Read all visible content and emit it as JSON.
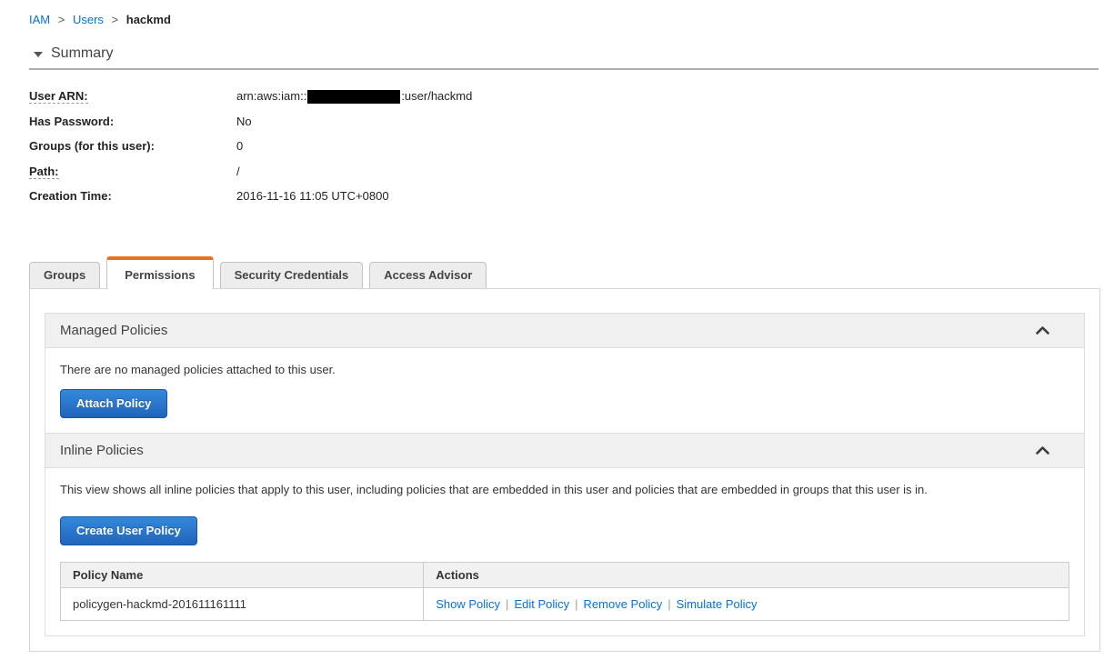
{
  "breadcrumb": {
    "separator": ">",
    "items": [
      {
        "label": "IAM"
      },
      {
        "label": "Users"
      },
      {
        "label": "hackmd"
      }
    ]
  },
  "summary": {
    "title": "Summary",
    "fields": [
      {
        "label": "User ARN:",
        "value_prefix": "arn:aws:iam::",
        "value_redacted": "account-id-redacted",
        "value_suffix": ":user/hackmd"
      },
      {
        "label": "Has Password:",
        "value": "No"
      },
      {
        "label": "Groups (for this user):",
        "value": "0"
      },
      {
        "label": "Path:",
        "value": "/"
      },
      {
        "label": "Creation Time:",
        "value": "2016-11-16 11:05 UTC+0800"
      }
    ]
  },
  "tabs": [
    {
      "label": "Groups",
      "active": false
    },
    {
      "label": "Permissions",
      "active": true
    },
    {
      "label": "Security Credentials",
      "active": false
    },
    {
      "label": "Access Advisor",
      "active": false
    }
  ],
  "managed_policies": {
    "title": "Managed Policies",
    "empty_message": "There are no managed policies attached to this user.",
    "attach_button": "Attach Policy"
  },
  "inline_policies": {
    "title": "Inline Policies",
    "description": "This view shows all inline policies that apply to this user, including policies that are embedded in this user and policies that are embedded in groups that this user is in.",
    "create_button": "Create User Policy",
    "actions_separator": "|",
    "table": {
      "columns": [
        "Policy Name",
        "Actions"
      ],
      "rows": [
        {
          "policy_name": "policygen-hackmd-201611161111",
          "actions": [
            "Show Policy",
            "Edit Policy",
            "Remove Policy",
            "Simulate Policy"
          ]
        }
      ]
    }
  },
  "colors": {
    "accent_orange": "#e8711d",
    "link_blue": "#0273d9",
    "button_blue_top": "#3389d9",
    "button_blue_bottom": "#2164bc",
    "section_header_bg": "#f0f0f0",
    "redaction": "#000000"
  }
}
